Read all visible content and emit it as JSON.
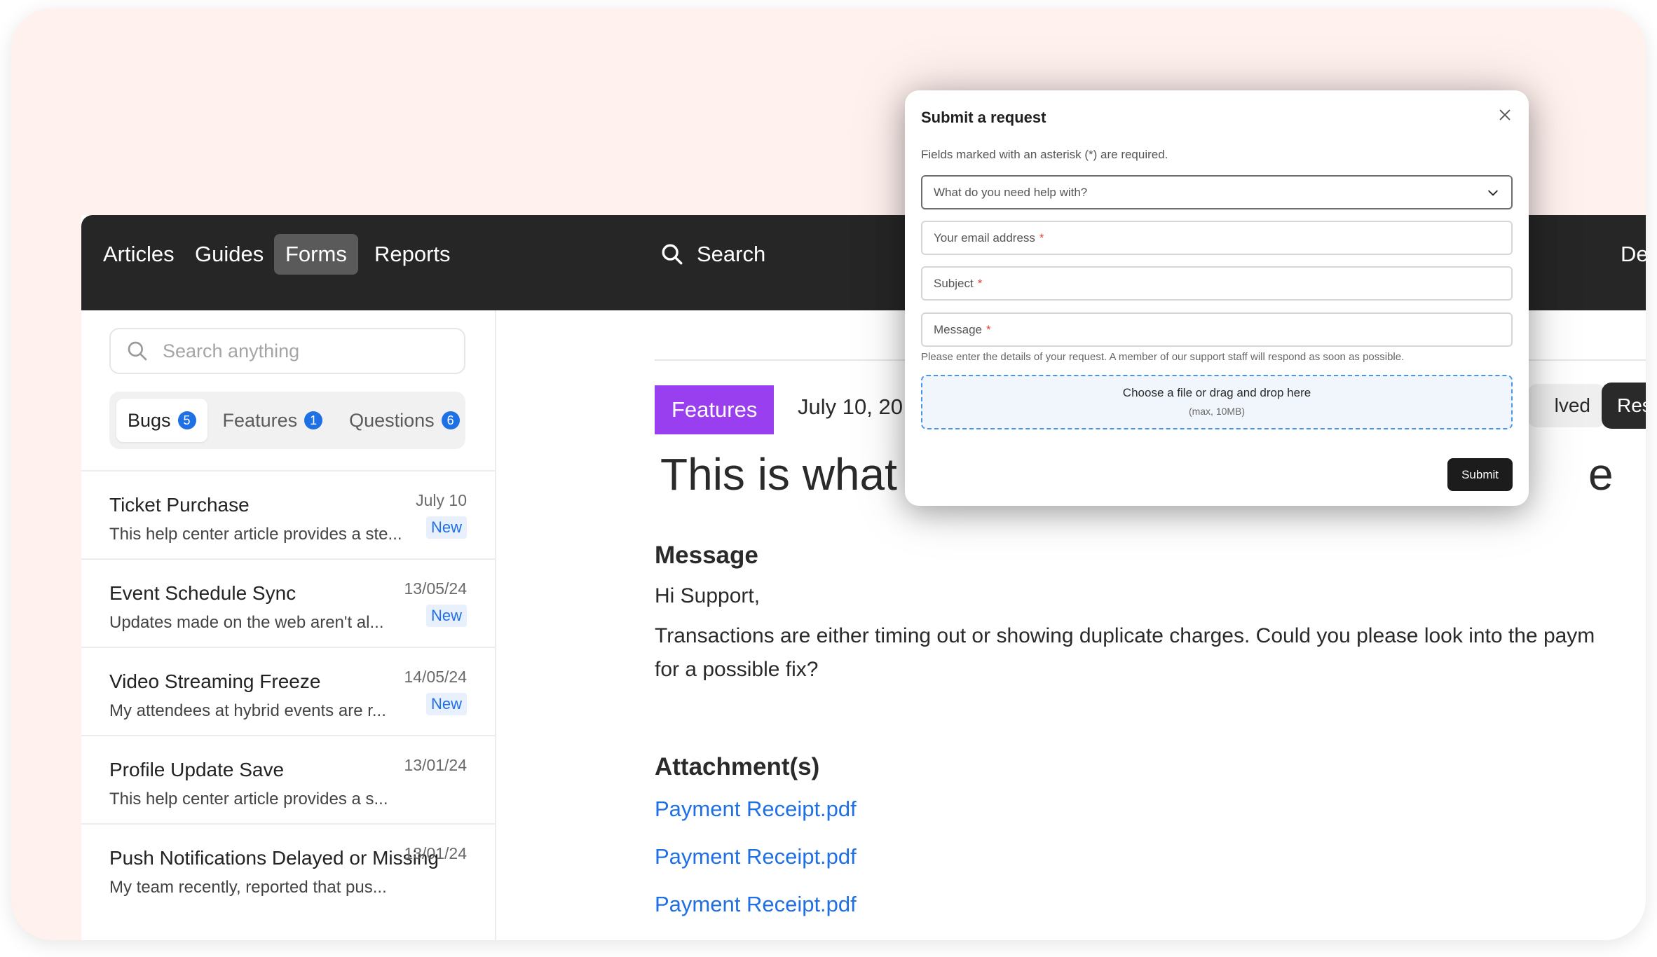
{
  "nav": {
    "items": [
      "Articles",
      "Guides",
      "Forms",
      "Reports"
    ],
    "active_index": 2,
    "search_label": "Search",
    "right_label_partial": "Des"
  },
  "sidebar": {
    "search_placeholder": "Search anything",
    "tabs": [
      {
        "label": "Bugs",
        "count": "5"
      },
      {
        "label": "Features",
        "count": "1"
      },
      {
        "label": "Questions",
        "count": "6"
      }
    ],
    "tickets": [
      {
        "title": "Ticket Purchase",
        "snippet": "This help center article provides a ste...",
        "date": "July 10",
        "badge": "New"
      },
      {
        "title": "Event Schedule Sync",
        "snippet": "Updates made on the web aren't al...",
        "date": "13/05/24",
        "badge": "New"
      },
      {
        "title": "Video Streaming Freeze",
        "snippet": "My attendees at hybrid events are r...",
        "date": "14/05/24",
        "badge": "New"
      },
      {
        "title": "Profile Update Save",
        "snippet": "This help center article provides a s...",
        "date": "13/01/24",
        "badge": ""
      },
      {
        "title": "Push Notifications Delayed or Missing",
        "snippet": "My team recently, reported that pus...",
        "date": "13/01/24",
        "badge": ""
      }
    ]
  },
  "main": {
    "tag": "Features",
    "date_partial": "July 10, 20",
    "status_partial": "lved",
    "respond_partial": "Resp",
    "headline_left": "This is what",
    "headline_right": "e",
    "message_heading": "Message",
    "greeting": "Hi Support,",
    "body_line1": "Transactions are either timing out or showing duplicate charges. Could you please look into the paym",
    "body_line2": "for a possible fix?",
    "attachments_heading": "Attachment(s)",
    "attachments": [
      "Payment Receipt.pdf",
      "Payment Receipt.pdf",
      "Payment Receipt.pdf"
    ]
  },
  "modal": {
    "title": "Submit a request",
    "note": "Fields marked with an asterisk (*) are required.",
    "help_select_placeholder": "What do you need help with?",
    "email_placeholder": "Your email address",
    "subject_placeholder": "Subject",
    "message_placeholder": "Message",
    "required_mark": "*",
    "help_text": "Please enter the details of your request. A member of our support staff will respond as soon as possible.",
    "dropzone_main": "Choose a file or drag and drop here",
    "dropzone_sub": "(max, 10MB)",
    "submit_label": "Submit"
  },
  "colors": {
    "page_bg": "#fff1ee",
    "nav_bg": "#262626",
    "accent_blue": "#1f6fe5",
    "features_tag": "#9a3ff0",
    "required_red": "#e0443a"
  },
  "icons": [
    "search-icon",
    "close-icon",
    "chevron-down-icon"
  ]
}
